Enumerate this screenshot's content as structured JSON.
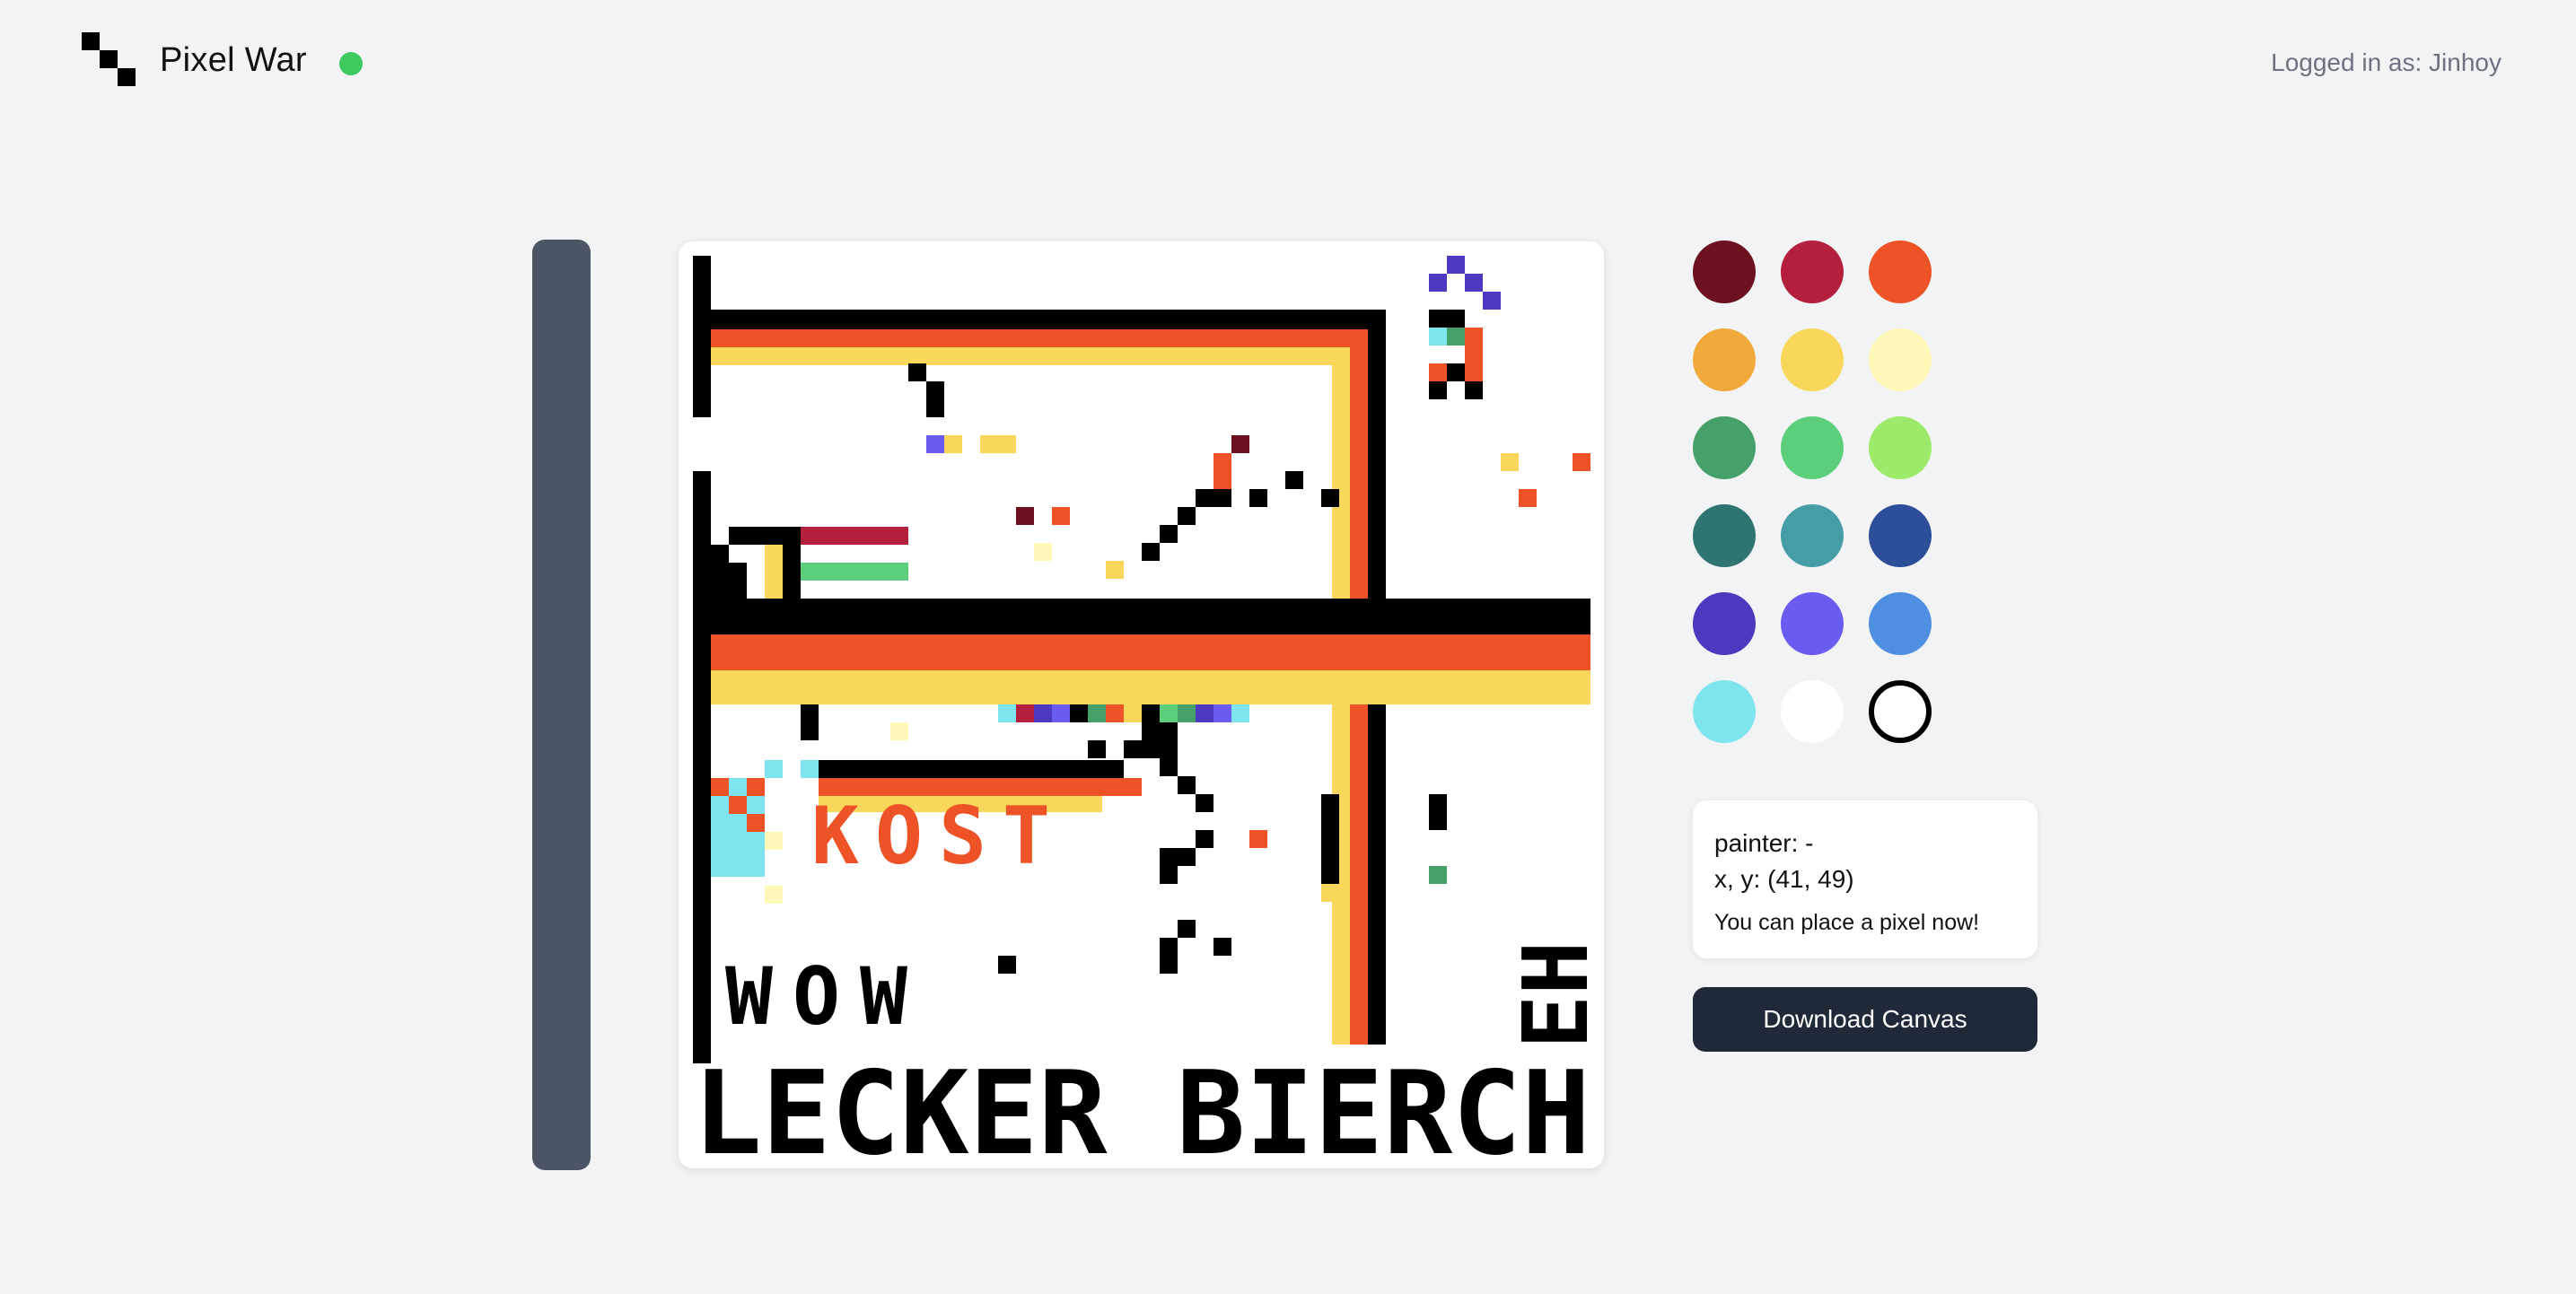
{
  "header": {
    "app_title": "Pixel War",
    "logo_icon": "pixel-logo-icon",
    "connection_status_color": "#3fca5f",
    "login_text": "Logged in as: Jinhoy"
  },
  "palette": {
    "colors": [
      "#6d1120",
      "#b41f3d",
      "#ed5327",
      "#f2a93b",
      "#f8d75b",
      "#fff8b8",
      "#46a06a",
      "#5ccf7d",
      "#9de96a",
      "#2e7470",
      "#459da5",
      "#2d4f9a",
      "#4b3abf",
      "#6b5cf1",
      "#4f8fe2",
      "#7ee5ef",
      "#ffffff",
      "#ffffff"
    ],
    "selected_index": 17
  },
  "info": {
    "painter": "painter: -",
    "coords": "x, y: (41, 49)",
    "status": "You can place a pixel now!"
  },
  "download_label": "Download Canvas",
  "canvas_colors": {
    "black": "#000000",
    "orange": "#ed5327",
    "yellow": "#f8d75b",
    "cyan": "#7ee5ef",
    "red": "#b41f3d",
    "green": "#5ccf7d",
    "dark_red": "#6d1120",
    "purple": "#4b3abf",
    "violet": "#6b5cf1",
    "light_yellow": "#fff8b8",
    "teal_green": "#46a06a"
  },
  "canvas_text": {
    "word1": "KOST",
    "word2": "WOW",
    "word3": "LECKER BIERCH",
    "word4": "EH"
  }
}
